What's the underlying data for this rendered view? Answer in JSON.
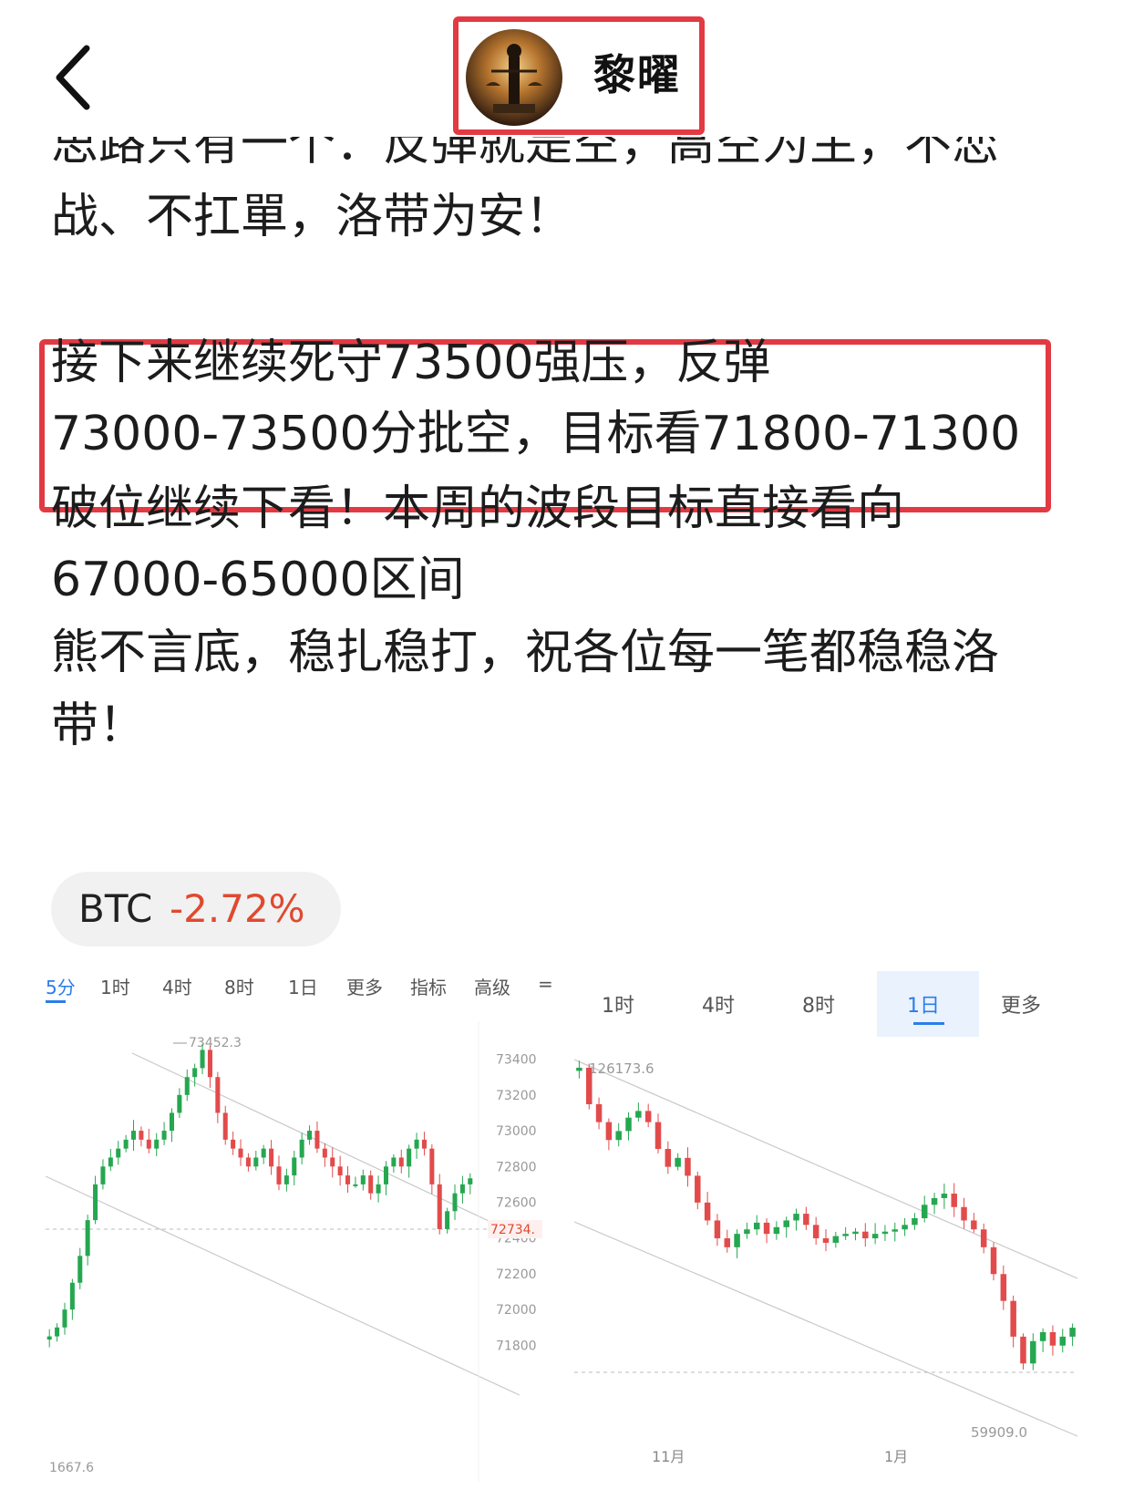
{
  "header": {
    "back_icon": "chevron-left-icon",
    "username": "黎曜",
    "accent_color": "#e23a43"
  },
  "post": {
    "line_partial": "思路只有一个：反弹就是空，高空为主，不恋",
    "line2": "战、不扛單，洛带为安！",
    "highlight_line1": "接下来继续死守73500强压，反弹",
    "highlight_line2": "73000-73500分批空，目标看71800-71300",
    "line5": "破位继续下看！本周的波段目标直接看向",
    "line6": "67000-65000区间",
    "line7": "熊不言底，稳扎稳打，祝各位每一笔都稳稳洛",
    "line8": "带！"
  },
  "ticker": {
    "symbol": "BTC",
    "change": "-2.72%",
    "change_color": "#e0492f"
  },
  "chart_left": {
    "tabs": [
      "5分",
      "1时",
      "4时",
      "8时",
      "1日",
      "更多",
      "指标",
      "高级",
      "="
    ],
    "active_tab": "5分",
    "high_label": "73452.3",
    "low_label": "1667.6",
    "current_price": "72734.",
    "y_ticks": [
      "73400",
      "73200",
      "73000",
      "72800",
      "72600",
      "72400",
      "72200",
      "72000",
      "71800"
    ]
  },
  "chart_right": {
    "tabs": [
      "1时",
      "4时",
      "8时",
      "1日",
      "更多"
    ],
    "active_tab": "1日",
    "high_label": "126173.6",
    "low_label": "59909.0",
    "x_ticks": [
      "11月",
      "1月"
    ]
  },
  "chart_data": [
    {
      "type": "candlestick",
      "timeframe": "5分",
      "annotations": [
        "73452.3",
        "1667.6",
        "72734."
      ],
      "y_ticks": [
        73400,
        73200,
        73000,
        72800,
        72600,
        72400,
        72200,
        72000,
        71800
      ],
      "ylim": [
        71700,
        73500
      ],
      "current_price": 72734,
      "overlay": "descending channel",
      "close_series": [
        71850,
        71900,
        72000,
        72150,
        72300,
        72500,
        72700,
        72800,
        72850,
        72900,
        72950,
        73000,
        72950,
        72900,
        72950,
        73000,
        73100,
        73200,
        73300,
        73350,
        73452,
        73300,
        73100,
        72950,
        72900,
        72850,
        72800,
        72850,
        72900,
        72800,
        72700,
        72750,
        72850,
        72950,
        73000,
        72900,
        72850,
        72800,
        72750,
        72700,
        72700,
        72750,
        72650,
        72700,
        72800,
        72850,
        72800,
        72900,
        72950,
        72900,
        72700,
        72450,
        72550,
        72650,
        72700,
        72734
      ]
    },
    {
      "type": "candlestick",
      "timeframe": "1日",
      "annotations": [
        "126173.6",
        "59909.0"
      ],
      "x_ticks": [
        "11月",
        "1月"
      ],
      "ylim": [
        57000,
        128000
      ],
      "overlay": "descending channel",
      "close_series": [
        126173,
        118000,
        114000,
        110000,
        112000,
        115000,
        116500,
        114000,
        108000,
        104000,
        106000,
        102000,
        96000,
        92000,
        88000,
        86000,
        89000,
        90000,
        91500,
        89000,
        90500,
        92000,
        93500,
        91000,
        88000,
        87000,
        88500,
        89000,
        89500,
        88000,
        89000,
        89500,
        90000,
        91000,
        92500,
        95500,
        97000,
        98000,
        95000,
        92000,
        90000,
        86000,
        80000,
        74000,
        66000,
        60000,
        65000,
        67000,
        64000,
        66000,
        68000
      ]
    }
  ]
}
